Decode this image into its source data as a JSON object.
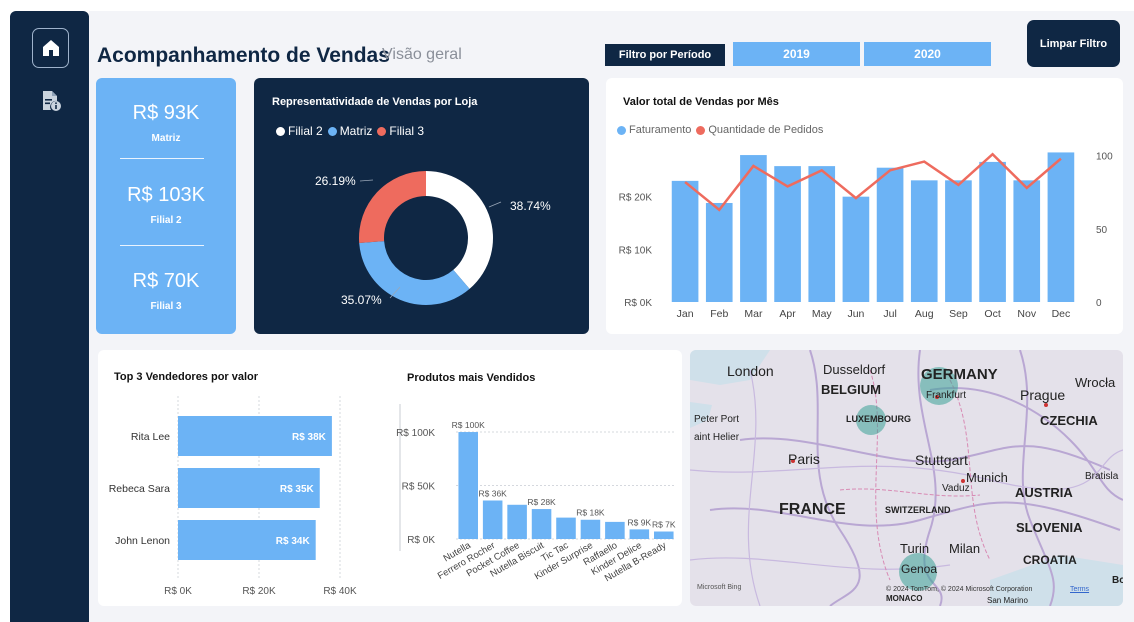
{
  "sidebar": {
    "home_icon": "home-icon",
    "report_icon": "file-info-icon"
  },
  "header": {
    "title": "Acompanhamento de Vendas",
    "subtitle": "Visão geral",
    "filter_label": "Filtro por Período",
    "years": [
      "2019",
      "2020"
    ],
    "clear_button": "Limpar Filtro"
  },
  "kpis": [
    {
      "value": "R$ 93K",
      "label": "Matriz"
    },
    {
      "value": "R$ 103K",
      "label": "Filial 2"
    },
    {
      "value": "R$ 70K",
      "label": "Filial 3"
    }
  ],
  "colors": {
    "navy": "#0f2744",
    "blue": "#6cb3f5",
    "red": "#ee6b5e",
    "white": "#ffffff"
  },
  "chart_data": [
    {
      "type": "donut",
      "title": "Representatividade de Vendas por Loja",
      "legend": [
        {
          "name": "Filial 2",
          "color": "#ffffff"
        },
        {
          "name": "Matriz",
          "color": "#6cb3f5"
        },
        {
          "name": "Filial 3",
          "color": "#ee6b5e"
        }
      ],
      "slices": [
        {
          "name": "Filial 2",
          "value": 38.74,
          "label": "38.74%",
          "color": "#ffffff"
        },
        {
          "name": "Matriz",
          "value": 35.07,
          "label": "35.07%",
          "color": "#6cb3f5"
        },
        {
          "name": "Filial 3",
          "value": 26.19,
          "label": "26.19%",
          "color": "#ee6b5e"
        }
      ]
    },
    {
      "type": "bar+line",
      "title": "Valor total de Vendas por Mês",
      "legend": [
        {
          "name": "Faturamento",
          "color": "#6cb3f5"
        },
        {
          "name": "Quantidade de Pedidos",
          "color": "#ee6b5e"
        }
      ],
      "categories": [
        "Jan",
        "Feb",
        "Mar",
        "Apr",
        "May",
        "Jun",
        "Jul",
        "Aug",
        "Sep",
        "Oct",
        "Nov",
        "Dec"
      ],
      "series": [
        {
          "name": "Faturamento",
          "type": "bar",
          "axis": "left",
          "values": [
            23000,
            18800,
            27900,
            25800,
            25800,
            20000,
            25500,
            23100,
            23100,
            26600,
            23100,
            28400
          ]
        },
        {
          "name": "Quantidade de Pedidos",
          "type": "line",
          "axis": "right",
          "values": [
            82,
            63,
            93,
            79,
            90,
            71,
            90,
            96,
            80,
            101,
            78,
            98
          ]
        }
      ],
      "y_left": {
        "ticks": [
          "R$ 0K",
          "R$ 10K",
          "R$ 20K"
        ],
        "tick_values": [
          0,
          10000,
          20000
        ],
        "range": [
          0,
          30000
        ]
      },
      "y_right": {
        "ticks": [
          "0",
          "50",
          "100"
        ],
        "tick_values": [
          0,
          50,
          100
        ],
        "range": [
          0,
          108
        ]
      }
    },
    {
      "type": "bar-horizontal",
      "title": "Top 3 Vendedores por valor",
      "categories": [
        "Rita Lee",
        "Rebeca Sara",
        "John Lenon"
      ],
      "values": [
        38000,
        35000,
        34000
      ],
      "data_labels": [
        "R$ 38K",
        "R$ 35K",
        "R$ 34K"
      ],
      "x_ticks": [
        "R$ 0K",
        "R$ 20K",
        "R$ 40K"
      ],
      "x_tick_values": [
        0,
        20000,
        40000
      ],
      "xlim": [
        0,
        40000
      ]
    },
    {
      "type": "bar",
      "title": "Produtos mais Vendidos",
      "categories": [
        "Nutella",
        "Ferrero Rocher",
        "Pocket Coffee",
        "Nutella Biscuit",
        "Tic Tac",
        "Kinder Surprise",
        "Raffaello",
        "Kinder Delice",
        "Nutella B-Ready"
      ],
      "values": [
        100000,
        36000,
        32000,
        28000,
        20000,
        18000,
        16000,
        9000,
        7000
      ],
      "data_labels": [
        "R$ 100K",
        "R$ 36K",
        "",
        "R$ 28K",
        "",
        "R$ 18K",
        "",
        "R$ 9K",
        "R$ 7K"
      ],
      "y_ticks": [
        "R$ 0K",
        "R$ 50K",
        "R$ 100K"
      ],
      "y_tick_values": [
        0,
        50000,
        100000
      ],
      "ylim": [
        0,
        115000
      ]
    }
  ],
  "map": {
    "labels": [
      "London",
      "Dusseldorf",
      "BELGIUM",
      "GERMANY",
      "Frankfurt",
      "Wrocła",
      "Prague",
      "CZECHIA",
      "Peter Port",
      "aint Helier",
      "LUXEMBOURG",
      "Paris",
      "Stuttgart",
      "Munich",
      "Vaduz",
      "AUSTRIA",
      "Bratisla",
      "FRANCE",
      "SWITZERLAND",
      "SLOVENIA",
      "Turin",
      "Milan",
      "CROATIA",
      "Genoa",
      "MONACO",
      "San Marino",
      "Bo"
    ],
    "attribution": "© 2024 TomTom, © 2024 Microsoft Corporation",
    "terms": "Terms",
    "brand": "Microsoft Bing"
  }
}
